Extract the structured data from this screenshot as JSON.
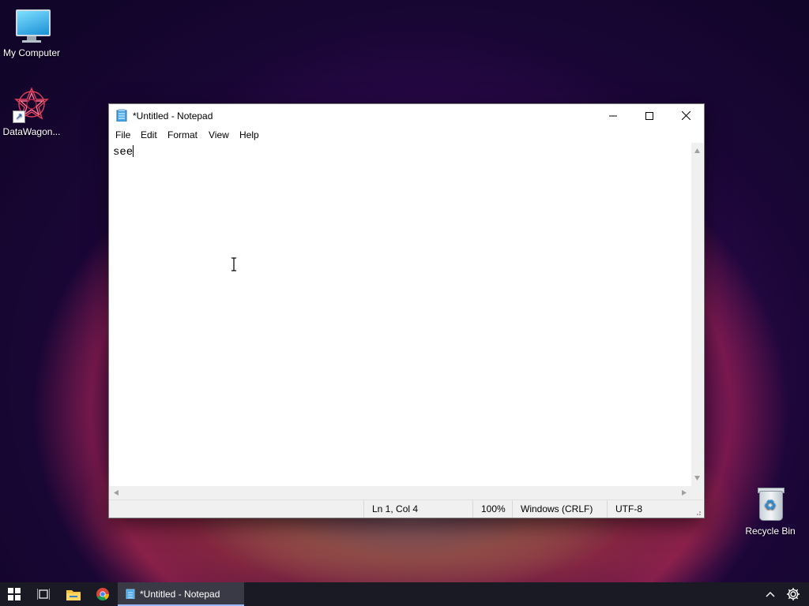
{
  "desktop": {
    "icons": [
      {
        "label": "My Computer",
        "icon": "monitor-icon"
      },
      {
        "label": "DataWagon...",
        "icon": "datawagon-icon"
      },
      {
        "label": "Recycle Bin",
        "icon": "recycle-bin-icon"
      }
    ]
  },
  "window": {
    "title": "*Untitled - Notepad",
    "app_icon": "notepad-icon",
    "controls": {
      "minimize": "minimize-icon",
      "maximize": "maximize-icon",
      "close": "close-icon"
    },
    "menu": [
      "File",
      "Edit",
      "Format",
      "View",
      "Help"
    ],
    "editor_text": "see",
    "status": {
      "position": "Ln 1, Col 4",
      "zoom": "100%",
      "line_ending": "Windows (CRLF)",
      "encoding": "UTF-8"
    }
  },
  "taskbar": {
    "start_icon": "windows-start-icon",
    "task_view_icon": "task-view-icon",
    "explorer_icon": "file-explorer-icon",
    "browser_icon": "chrome-icon",
    "active_app_label": "*Untitled - Notepad",
    "tray_chevron_icon": "chevron-up-icon",
    "settings_icon": "gear-icon"
  },
  "colors": {
    "taskbar_bg": "#1a1a24",
    "active_task_accent": "#9bb8ff",
    "window_chrome": "#f0f0f0"
  }
}
